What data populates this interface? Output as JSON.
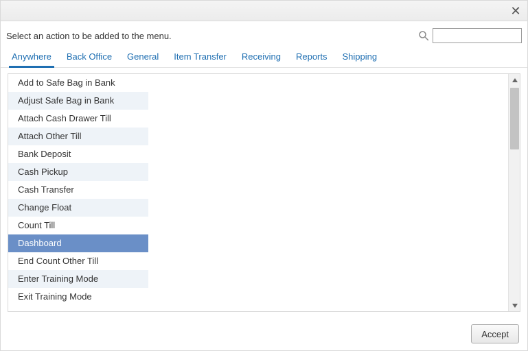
{
  "prompt": "Select an action to be added to the menu.",
  "search": {
    "value": ""
  },
  "tabs": [
    {
      "label": "Anywhere",
      "active": true
    },
    {
      "label": "Back Office",
      "active": false
    },
    {
      "label": "General",
      "active": false
    },
    {
      "label": "Item Transfer",
      "active": false
    },
    {
      "label": "Receiving",
      "active": false
    },
    {
      "label": "Reports",
      "active": false
    },
    {
      "label": "Shipping",
      "active": false
    }
  ],
  "actions": [
    {
      "label": "Add to Safe Bag in Bank",
      "selected": false
    },
    {
      "label": "Adjust Safe Bag in Bank",
      "selected": false
    },
    {
      "label": "Attach Cash Drawer Till",
      "selected": false
    },
    {
      "label": "Attach Other Till",
      "selected": false
    },
    {
      "label": "Bank Deposit",
      "selected": false
    },
    {
      "label": "Cash Pickup",
      "selected": false
    },
    {
      "label": "Cash Transfer",
      "selected": false
    },
    {
      "label": "Change Float",
      "selected": false
    },
    {
      "label": "Count Till",
      "selected": false
    },
    {
      "label": "Dashboard",
      "selected": true
    },
    {
      "label": "End Count Other Till",
      "selected": false
    },
    {
      "label": "Enter Training Mode",
      "selected": false
    },
    {
      "label": "Exit Training Mode",
      "selected": false
    }
  ],
  "buttons": {
    "accept": "Accept"
  }
}
